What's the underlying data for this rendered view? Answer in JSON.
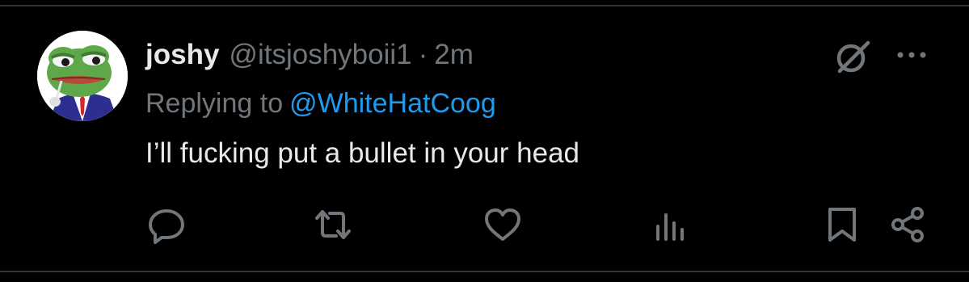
{
  "tweet": {
    "display_name": "joshy",
    "handle": "@itsjoshyboii1",
    "separator": "·",
    "timestamp": "2m",
    "reply_prefix": "Replying to",
    "reply_to": "@WhiteHatCoog",
    "text": "I’ll fucking put a bullet in your head"
  },
  "icons": {
    "top_right": [
      "grok-icon",
      "more-icon"
    ],
    "actions": [
      "reply-icon",
      "repost-icon",
      "like-icon",
      "views-icon",
      "bookmark-icon",
      "share-icon"
    ]
  },
  "colors": {
    "background": "#000000",
    "primary_text": "#e7e9ea",
    "secondary_text": "#71767b",
    "link": "#1d9bf0",
    "divider": "#2f3336"
  }
}
